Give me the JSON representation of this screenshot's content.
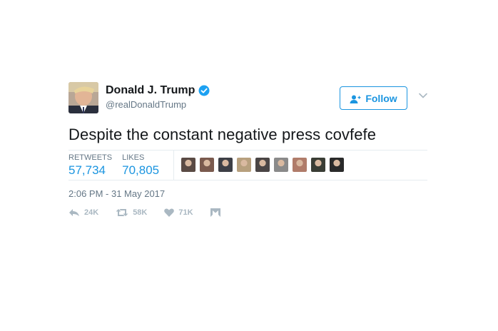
{
  "user": {
    "display_name": "Donald J. Trump",
    "screen_name": "@realDonaldTrump",
    "verified": true
  },
  "follow_button": {
    "label": "Follow"
  },
  "tweet": {
    "text": "Despite the constant negative press covfefe"
  },
  "stats": {
    "retweets_label": "RETWEETS",
    "retweets_value": "57,734",
    "likes_label": "LIKES",
    "likes_value": "70,805"
  },
  "likers": [
    {
      "name": "liker-1",
      "color": "#5a4a44"
    },
    {
      "name": "liker-2",
      "color": "#7a5a4e"
    },
    {
      "name": "liker-3",
      "color": "#3d3f46"
    },
    {
      "name": "liker-4",
      "color": "#b7a07e"
    },
    {
      "name": "liker-5",
      "color": "#4a4545"
    },
    {
      "name": "liker-6",
      "color": "#8a8a8a"
    },
    {
      "name": "liker-7",
      "color": "#b07c6a"
    },
    {
      "name": "liker-8",
      "color": "#3a3d35"
    },
    {
      "name": "liker-9",
      "color": "#2a2a2a"
    }
  ],
  "timestamp": "2:06 PM - 31 May 2017",
  "actions": {
    "reply_count": "24K",
    "retweet_count": "58K",
    "like_count": "71K"
  },
  "colors": {
    "accent": "#1b95e0",
    "text": "#14171a",
    "muted": "#657786",
    "icon": "#aab8c2"
  }
}
